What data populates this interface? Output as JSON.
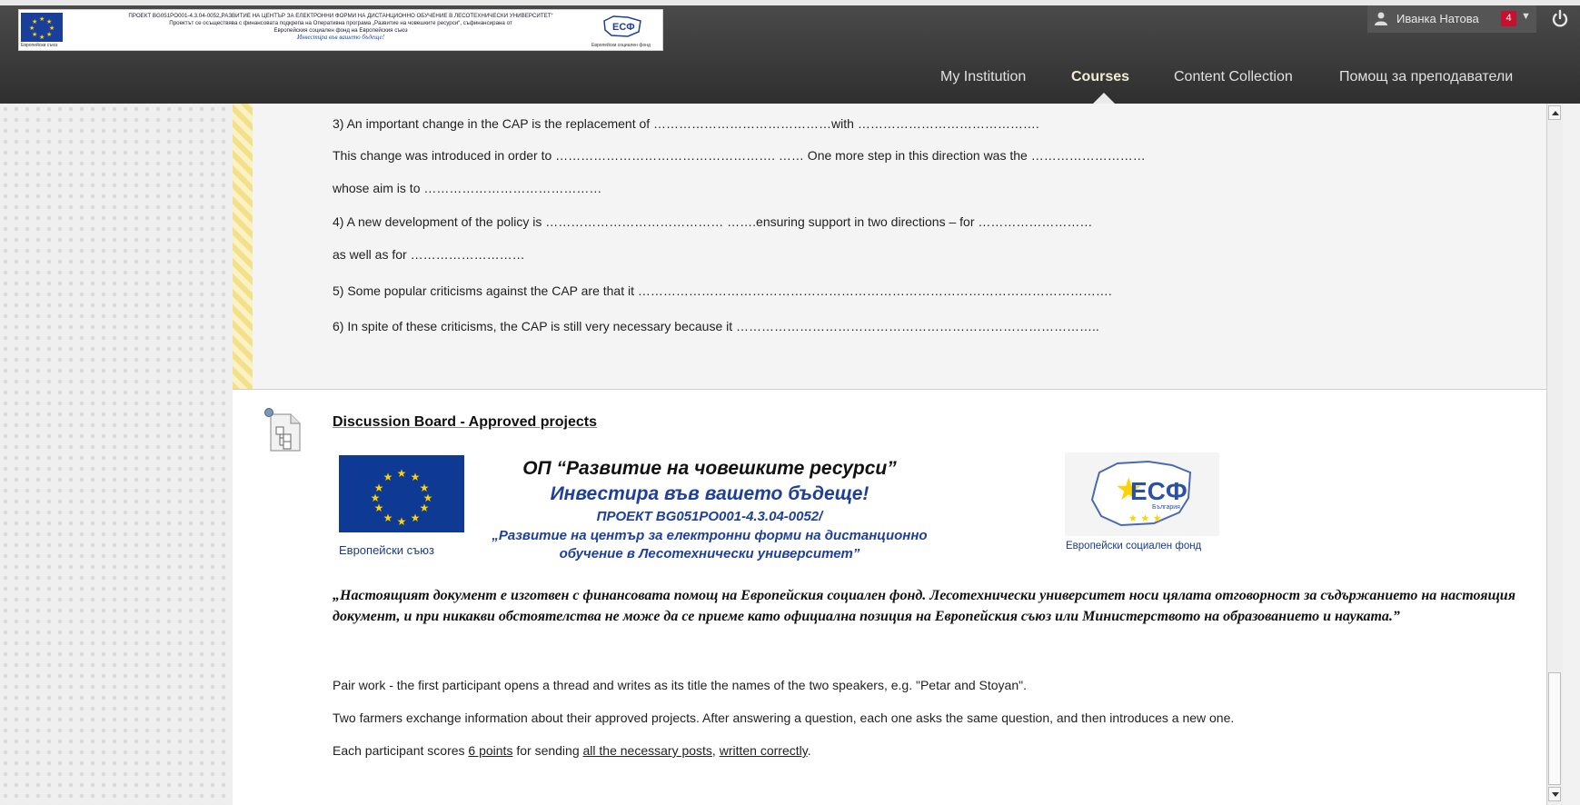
{
  "banner": {
    "line1": "ПРОЕКТ BG051PO001-4.3.04-0052„РАЗВИТИЕ НА ЦЕНТЪР ЗА ЕЛЕКТРОННИ ФОРМИ НА ДИСТАНЦИОННО ОБУЧЕНИЕ В ЛЕСОТЕХНИЧЕСКИ УНИВЕРСИТЕТ“",
    "line2": "Проектът се осъществява с финансовата подкрепа на Оперативна програма „Развитие на човешките ресурси“, съфинансирана от",
    "line3": "Европейския социален фонд на Европейския съюз",
    "line4": "Инвестира във вашето бъдеще!",
    "eu_caption": "Европейски съюз",
    "esf_caption": "Европейски социален фонд"
  },
  "user": {
    "name": "Иванка Натова",
    "notification_count": "4",
    "icon": "user-icon"
  },
  "nav": {
    "tabs": [
      "My Institution",
      "Courses",
      "Content Collection",
      "Помощ за преподаватели"
    ],
    "active": "Courses"
  },
  "questions": [
    "3) An important change in the CAP is the replacement of ……………………………………with …………………………………….",
    "This change was introduced in order to ……………………………………………. …… One more step in this direction was the ………………………",
    "whose aim is to ……………………………………",
    "4) A new development of the policy is …………………………………… …….ensuring support in two directions – for ………………………",
    "as well as for ………………………",
    "5) Some popular criticisms against the CAP are that it  ………………………………………………………………………………………………….",
    "6) In spite of these criticisms, the CAP is still very necessary because it ………………………………………………………………………….."
  ],
  "discussion": {
    "title": "Discussion Board - Approved projects",
    "icon": "discussion-board-icon",
    "project_title": "ОП “Развитие на човешките ресурси”",
    "project_slogan": "Инвестира във вашето бъдеще!",
    "project_code": "ПРОЕКТ BG051PO001-4.3.04-0052/",
    "project_desc_1": "„Развитие на център за електронни  форми на дистанционно",
    "project_desc_2": "обучение в Лесотехнически  университет”",
    "eu_caption": "Европейски съюз",
    "esf_caption": "Европейски социален фонд",
    "esf_logo_text": "ЕСФ",
    "esf_logo_country": "България",
    "disclaimer": "„Настоящият документ е изготвен с финансовата помощ на Европейския социален фонд. Лесотехнически университет носи цялата отговорност за съдържанието на настоящия документ, и при никакви обстоятелства не може да се приеме като официална позиция на Европейския съюз или Министерството на образованието и науката.”",
    "instruction_1": "Pair work - the first participant opens a thread and writes as its title the names of the two speakers, e.g. \"Petar and Stoyan\".",
    "instruction_2": "Two farmers exchange information about their approved projects. After answering a question, each one asks the same question, and then introduces a new one.",
    "instruction_3_a": "Each participant scores ",
    "instruction_3_link1": "6 points",
    "instruction_3_b": " for sending ",
    "instruction_3_link2": "all the necessary posts",
    "instruction_3_c": ", ",
    "instruction_3_link3": "written correctly",
    "instruction_3_d": "."
  },
  "colors": {
    "header_bg": "#3a3a3a",
    "active_tab": "#f2ecd4",
    "notification": "#c8102e",
    "eu_blue": "#0f3a94",
    "highlight_stripe": "#f3e08a"
  }
}
